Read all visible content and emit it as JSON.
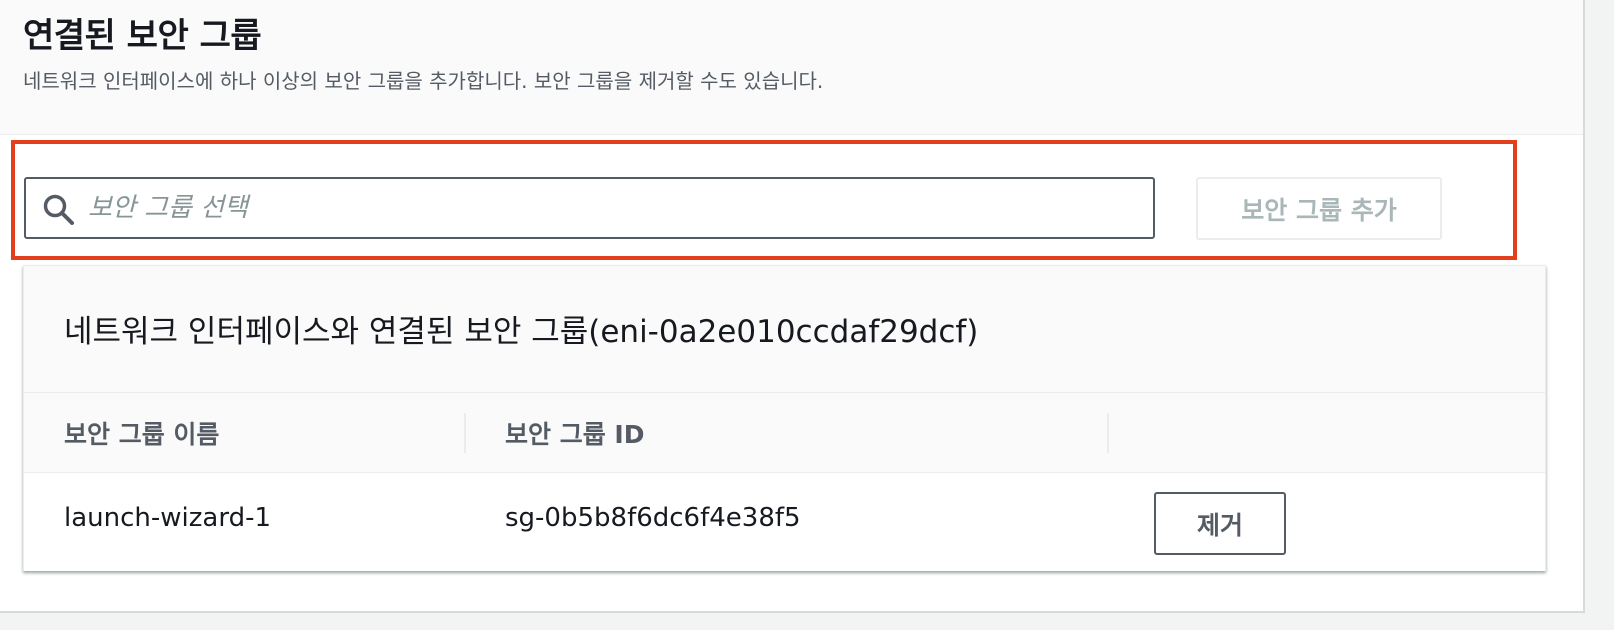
{
  "section": {
    "title": "연결된 보안 그룹",
    "description": "네트워크 인터페이스에 하나 이상의 보안 그룹을 추가합니다. 보안 그룹을 제거할 수도 있습니다."
  },
  "search": {
    "placeholder": "보안 그룹 선택",
    "value": ""
  },
  "add_button": {
    "label": "보안 그룹 추가",
    "disabled": true
  },
  "table": {
    "title": "네트워크 인터페이스와 연결된 보안 그룹(eni-0a2e010ccdaf29dcf)",
    "columns": [
      "보안 그룹 이름",
      "보안 그룹 ID",
      ""
    ],
    "rows": [
      {
        "name": "launch-wizard-1",
        "id": "sg-0b5b8f6dc6f4e38f5",
        "action_label": "제거"
      }
    ]
  },
  "icons": {
    "search": "search-icon"
  },
  "colors": {
    "highlight": "#e2401c",
    "text_primary": "#16191f",
    "text_secondary": "#545b64",
    "disabled_text": "#aab7b8"
  }
}
